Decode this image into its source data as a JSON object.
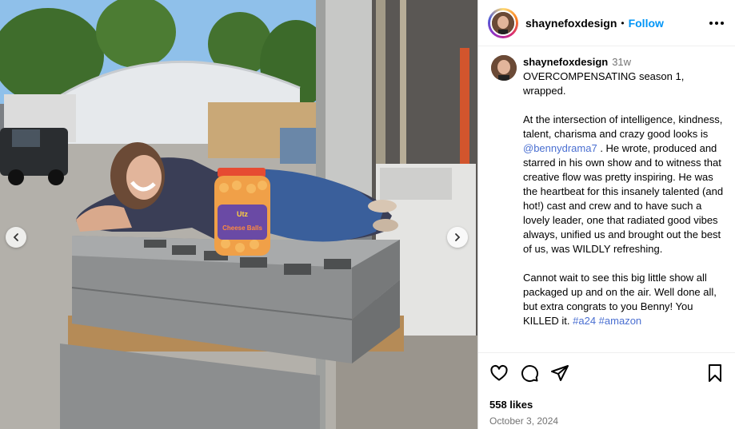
{
  "header": {
    "username": "shaynefoxdesign",
    "separator": "•",
    "follow_label": "Follow",
    "avatar_icon": "profile-avatar",
    "more_icon": "more-options-icon"
  },
  "photo": {
    "jar_label_top": "Utz",
    "jar_label_main": "Cheese Balls",
    "prev_icon": "chevron-left-icon",
    "next_icon": "chevron-right-icon"
  },
  "caption": {
    "username": "shaynefoxdesign",
    "time": "31w",
    "line1": "OVERCOMPENSATING season 1, wrapped.",
    "para2_before": "At the intersection of intelligence, kindness, talent, charisma and crazy good looks is ",
    "mention": "@bennydrama7",
    "para2_after": " . He wrote, produced and starred in his own show and to witness that creative flow was pretty inspiring. He was the heartbeat for this insanely talented (and hot!) cast and crew and to have such a lovely leader, one that radiated good vibes always, unified us and brought out the best of us, was WILDLY refreshing.",
    "para3": "Cannot wait to see this big little show all packaged up and on the air. Well done all, but extra congrats to you Benny! You KILLED it. ",
    "hashtags": "#a24 #amazon"
  },
  "actions": {
    "like_icon": "heart-icon",
    "comment_icon": "comment-icon",
    "share_icon": "share-icon",
    "save_icon": "bookmark-icon",
    "likes": "558 likes",
    "date": "October 3, 2024"
  },
  "colors": {
    "follow_blue": "#0095f6",
    "link_blue": "#4a6fd1",
    "muted": "#737373",
    "border": "#dbdbdb"
  }
}
